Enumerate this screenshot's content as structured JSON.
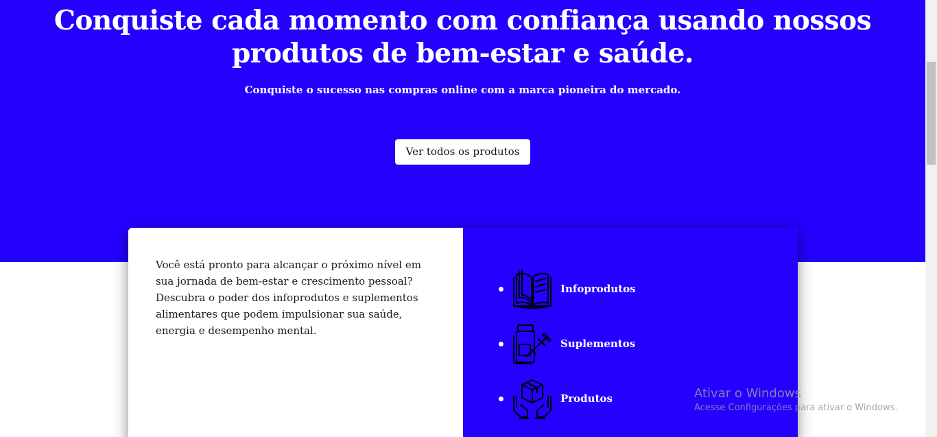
{
  "hero": {
    "title": "Conquiste cada momento com confiança usando nossos produtos de bem-estar e saúde.",
    "subtitle": "Conquiste o sucesso nas compras online com a marca pioneira do mercado.",
    "cta_label": "Ver todos os produtos",
    "background_color": "#2400ff"
  },
  "card": {
    "text": "Você está pronto para alcançar o próximo nível em sua jornada de bem-estar e crescimento pessoal? Descubra o poder dos infoprodutos e suplementos alimentares que podem impulsionar sua saúde, energia e desempenho mental.",
    "categories": [
      {
        "label": "Infoprodutos",
        "icon": "book-icon"
      },
      {
        "label": "Suplementos",
        "icon": "supplement-bottle-icon"
      },
      {
        "label": "Produtos",
        "icon": "box-in-hands-icon"
      }
    ]
  },
  "watermark": {
    "title": "Ativar o Windows",
    "subtitle": "Acesse Configurações para ativar o Windows."
  }
}
